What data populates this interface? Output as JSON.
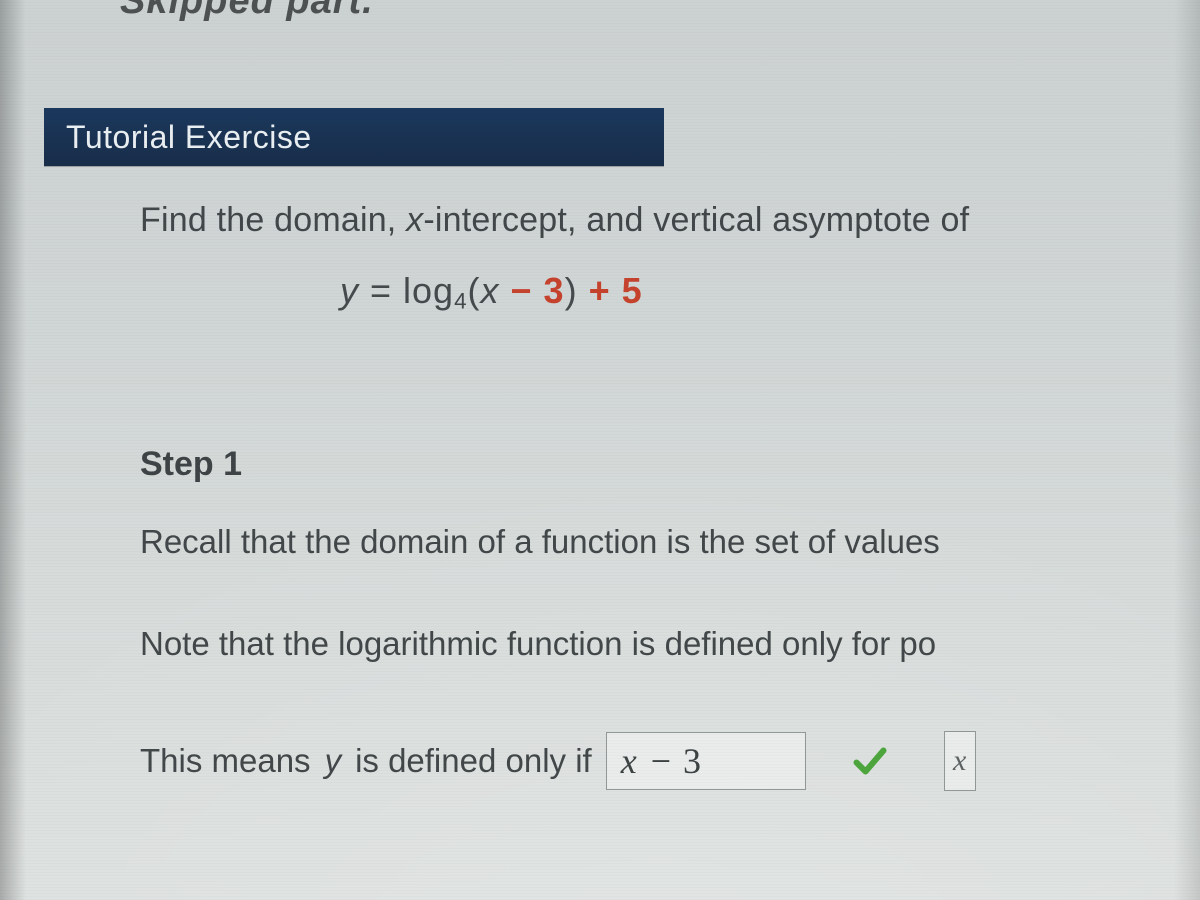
{
  "top_fragment": "Skipped part.",
  "banner": {
    "title": "Tutorial Exercise"
  },
  "prompt": {
    "text_before_x": "Find the domain, ",
    "x_word": "x",
    "text_after_x": "-intercept, and vertical asymptote of"
  },
  "equation": {
    "lhs_y": "y",
    "equals": " = ",
    "log_label": "log",
    "log_base": "4",
    "open": "(",
    "x": "x",
    "minus3": " − 3",
    "close": ")",
    "plus5": " + 5"
  },
  "step": {
    "label": "Step 1",
    "line1": "Recall that the domain of a function is the set of values",
    "line2": "Note that the logarithmic function is defined only for po"
  },
  "answer": {
    "prefix": "This means ",
    "y": "y",
    "middle": " is defined only if ",
    "box_x": "x",
    "box_dash": "−",
    "box_three": "3",
    "right_fragment": "x"
  },
  "icons": {
    "check": "check-icon"
  },
  "colors": {
    "banner_bg": "#18355a",
    "accent_red": "#c2402a",
    "check_green": "#4aa33a"
  }
}
